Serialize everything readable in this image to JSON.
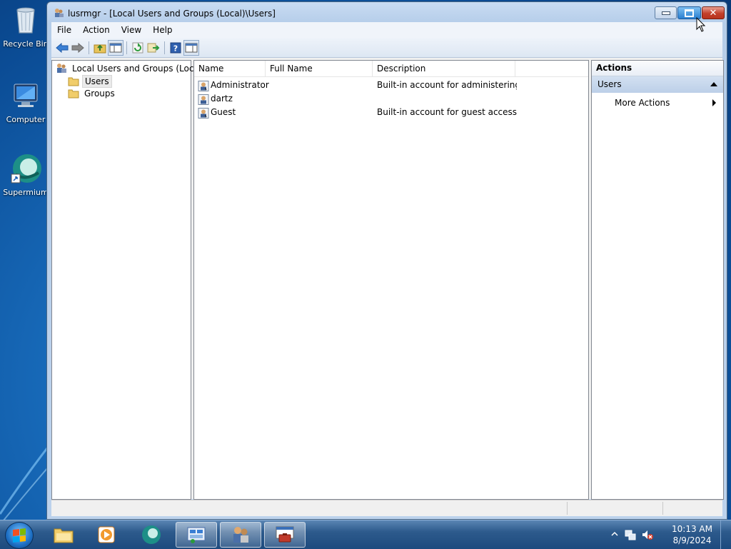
{
  "desktop": {
    "icons": [
      {
        "label": "Recycle Bin",
        "icon": "recycle-bin-icon"
      },
      {
        "label": "Computer",
        "icon": "computer-icon"
      },
      {
        "label": "Supermium",
        "icon": "supermium-icon"
      }
    ]
  },
  "window": {
    "title": "lusrmgr - [Local Users and Groups (Local)\\Users]",
    "menu": [
      "File",
      "Action",
      "View",
      "Help"
    ]
  },
  "tree": {
    "root": "Local Users and Groups (Local)",
    "children": [
      {
        "label": "Users",
        "selected": true
      },
      {
        "label": "Groups",
        "selected": false
      }
    ]
  },
  "list": {
    "columns": [
      "Name",
      "Full Name",
      "Description"
    ],
    "rows": [
      {
        "name": "Administrator",
        "full_name": "",
        "description": "Built-in account for administering..."
      },
      {
        "name": "dartz",
        "full_name": "",
        "description": ""
      },
      {
        "name": "Guest",
        "full_name": "",
        "description": "Built-in account for guest access t..."
      }
    ]
  },
  "actions": {
    "title": "Actions",
    "section": "Users",
    "items": [
      "More Actions"
    ]
  },
  "taskbar": {
    "time": "10:13 AM",
    "date": "8/9/2024"
  },
  "colors": {
    "selection": "#eaeaea",
    "actions_section": "#c9d9ee",
    "close_button": "#c2402b"
  }
}
